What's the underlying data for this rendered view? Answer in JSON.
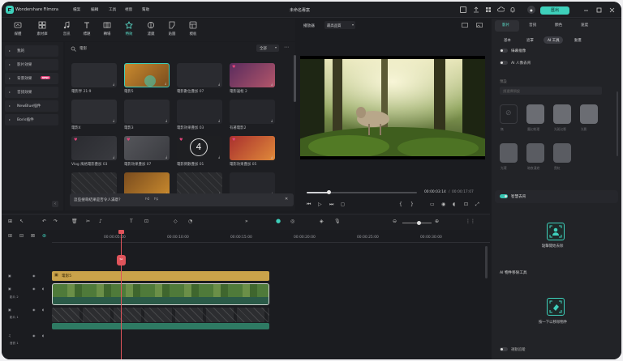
{
  "app": {
    "name": "Wondershare Filmora",
    "project_title": "未命名專案",
    "export_label": "匯出"
  },
  "menu": [
    "檔案",
    "編輯",
    "工具",
    "視窗",
    "幫助"
  ],
  "top_tabs": [
    {
      "label": "媒體",
      "icon": "media-icon"
    },
    {
      "label": "素材庫",
      "icon": "stock-icon"
    },
    {
      "label": "音訊",
      "icon": "audio-icon"
    },
    {
      "label": "標題",
      "icon": "title-icon"
    },
    {
      "label": "轉場",
      "icon": "transition-icon"
    },
    {
      "label": "特效",
      "icon": "effects-icon",
      "active": true
    },
    {
      "label": "濾鏡",
      "icon": "filter-icon"
    },
    {
      "label": "貼圖",
      "icon": "sticker-icon"
    },
    {
      "label": "模板",
      "icon": "template-icon"
    }
  ],
  "sidebar": {
    "items": [
      {
        "label": "我的"
      },
      {
        "label": "影片效果"
      },
      {
        "label": "背景效果",
        "badge": "NEW"
      },
      {
        "label": "音訊效果"
      },
      {
        "label": "NewBlue插件"
      },
      {
        "label": "Boris插件"
      }
    ]
  },
  "media": {
    "search_placeholder": "電影",
    "filter_label": "全部",
    "thumbnails": [
      {
        "label": "電影界 21:9"
      },
      {
        "label": "電影5"
      },
      {
        "label": "電影數位疊加 07"
      },
      {
        "label": "電影邊框 2"
      },
      {
        "label": "電影4"
      },
      {
        "label": "電影3"
      },
      {
        "label": "電影效果疊加 03"
      },
      {
        "label": "有著電影2"
      },
      {
        "label": "Vlog 風格電影疊加 03"
      },
      {
        "label": "電影效果疊加 07"
      },
      {
        "label": "電影倒數疊加 01"
      },
      {
        "label": "電影效果疊加 05"
      },
      {
        "label": ""
      },
      {
        "label": ""
      },
      {
        "label": ""
      },
      {
        "label": ""
      }
    ],
    "feedback_text": "這些搜尋結果是否令人滿意？"
  },
  "viewer": {
    "player_label": "播放器",
    "quality_label": "最高品質",
    "current_time": "00:00:03:14",
    "total_time": "00:00:17:07",
    "progress": 0.2
  },
  "right_panel": {
    "tabs": [
      "影片",
      "音訊",
      "顏色",
      "速度"
    ],
    "subtabs": [
      "基本",
      "遮罩",
      "AI 工具",
      "動畫"
    ],
    "active_subtab": "AI 工具",
    "rows": [
      "綠幕摳像",
      "AI 人像去背"
    ],
    "preset_title": "預設",
    "preset_select": "請選擇預設",
    "preset_items": [
      "無",
      "魔幻紋理",
      "光斑幻影",
      "光影",
      "光環",
      "暗夜漫遊",
      "霓虹",
      "彩虹光"
    ],
    "smart_cutout": {
      "label": "智慧去背",
      "button_label": "點擊開始去除"
    },
    "ai_remover": {
      "title": "AI 物件移除工具",
      "button_label": "按一下以移除物件"
    },
    "bottom_label": "運動追蹤"
  },
  "timeline": {
    "ruler": [
      "00:00:05:00",
      "00:00:10:00",
      "00:00:15:00",
      "00:00:20:00",
      "00:00:25:00",
      "00:00:30:00"
    ],
    "effect_clip_label": "電影5",
    "track_labels": [
      "影片 2",
      "影片 1",
      "音訊 1"
    ]
  },
  "colors": {
    "accent": "#3ed0bb",
    "effect_clip": "#c9a24a",
    "video_clip": "#2e7a63",
    "playhead": "#e0545b"
  }
}
